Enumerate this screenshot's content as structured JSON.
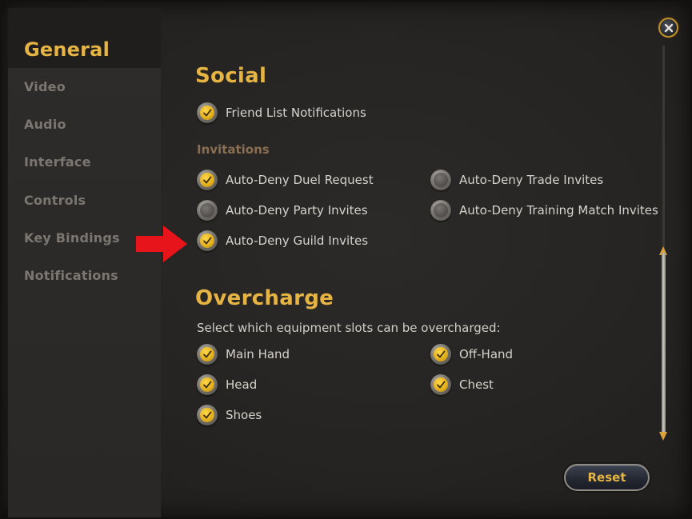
{
  "sidebar": {
    "items": [
      {
        "label": "General",
        "active": true
      },
      {
        "label": "Video"
      },
      {
        "label": "Audio"
      },
      {
        "label": "Interface"
      },
      {
        "label": "Controls"
      },
      {
        "label": "Key Bindings"
      },
      {
        "label": "Notifications"
      }
    ]
  },
  "social": {
    "title": "Social",
    "friend_list": {
      "label": "Friend List Notifications",
      "checked": true
    },
    "invitations_heading": "Invitations",
    "invitations": [
      {
        "label": "Auto-Deny Duel Request",
        "checked": true
      },
      {
        "label": "Auto-Deny Trade Invites",
        "checked": false
      },
      {
        "label": "Auto-Deny Party Invites",
        "checked": false
      },
      {
        "label": "Auto-Deny Training Match Invites",
        "checked": false
      },
      {
        "label": "Auto-Deny Guild Invites",
        "checked": true
      }
    ]
  },
  "overcharge": {
    "title": "Overcharge",
    "description": "Select which equipment slots can be overcharged:",
    "slots": [
      {
        "label": "Main Hand",
        "checked": true
      },
      {
        "label": "Off-Hand",
        "checked": true
      },
      {
        "label": "Head",
        "checked": true
      },
      {
        "label": "Chest",
        "checked": true
      },
      {
        "label": "Shoes",
        "checked": true
      }
    ]
  },
  "buttons": {
    "reset_label": "Reset",
    "close_icon": "close-icon"
  },
  "colors": {
    "accent": "#e6b443",
    "check_on": "#e4b21e",
    "annotation_arrow": "#e8141c"
  }
}
